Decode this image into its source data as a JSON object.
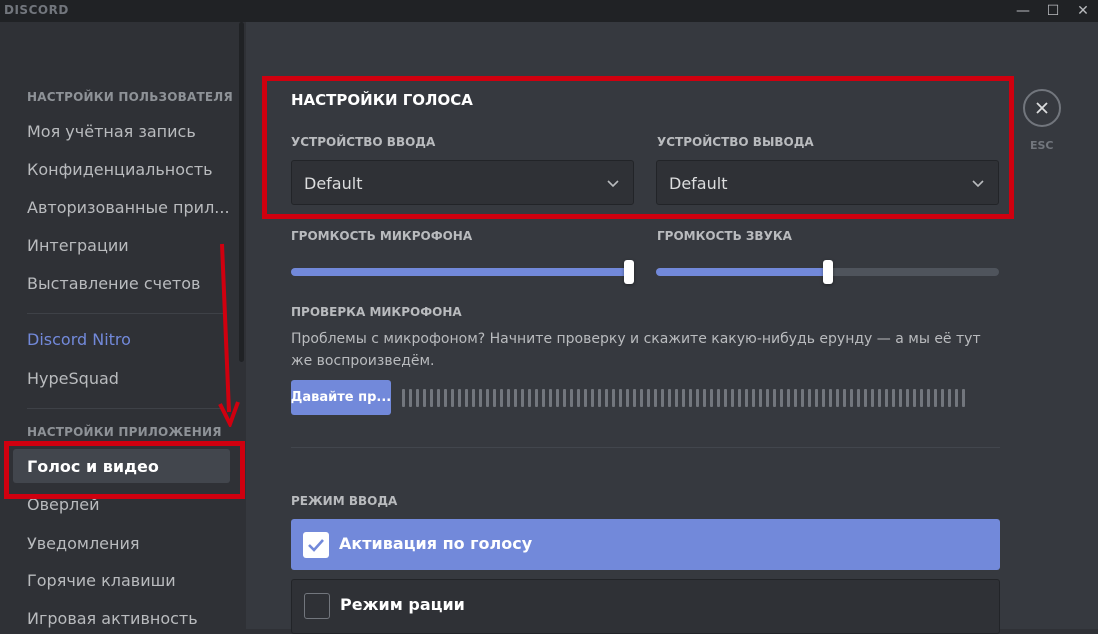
{
  "titlebar": {
    "logo": "DISCORD",
    "minimize_icon": "—",
    "maximize_icon": "☐",
    "close_icon": "✕"
  },
  "sidebar": {
    "user_settings_header": "НАСТРОЙКИ ПОЛЬЗОВАТЕЛЯ",
    "user_items": [
      {
        "label": "Моя учётная запись"
      },
      {
        "label": "Конфиденциальность"
      },
      {
        "label": "Авторизованные прил..."
      },
      {
        "label": "Интеграции"
      },
      {
        "label": "Выставление счетов"
      }
    ],
    "nitro_label": "Discord Nitro",
    "hypesquad_label": "HypeSquad",
    "app_settings_header": "НАСТРОЙКИ ПРИЛОЖЕНИЯ",
    "app_items": [
      {
        "label": "Голос и видео",
        "active": true
      },
      {
        "label": "Оверлей"
      },
      {
        "label": "Уведомления"
      },
      {
        "label": "Горячие клавиши"
      },
      {
        "label": "Игровая активность"
      }
    ]
  },
  "voice": {
    "title": "НАСТРОЙКИ ГОЛОСА",
    "input_device_label": "УСТРОЙСТВО ВВОДА",
    "input_device_value": "Default",
    "output_device_label": "УСТРОЙСТВО ВЫВОДА",
    "output_device_value": "Default",
    "mic_volume_label": "ГРОМКОСТЬ МИКРОФОНА",
    "mic_volume_fraction": 1.0,
    "sound_volume_label": "ГРОМКОСТЬ ЗВУКА",
    "sound_volume_fraction": 0.5,
    "mic_test_label": "ПРОВЕРКА МИКРОФОНА",
    "mic_test_description": "Проблемы с микрофоном? Начните проверку и скажите какую-нибудь ерунду — а мы её тут же воспроизведём.",
    "mic_test_button": "Давайте пр...",
    "input_mode_label": "РЕЖИМ ВВОДА",
    "modes": [
      {
        "label": "Активация по голосу",
        "checked": true
      },
      {
        "label": "Режим рации",
        "checked": false
      }
    ]
  },
  "close": {
    "esc_label": "ESC"
  },
  "colors": {
    "accent": "#7289da",
    "highlight": "#d0000f",
    "bg_main": "#36393f",
    "bg_sidebar": "#2f3136"
  }
}
